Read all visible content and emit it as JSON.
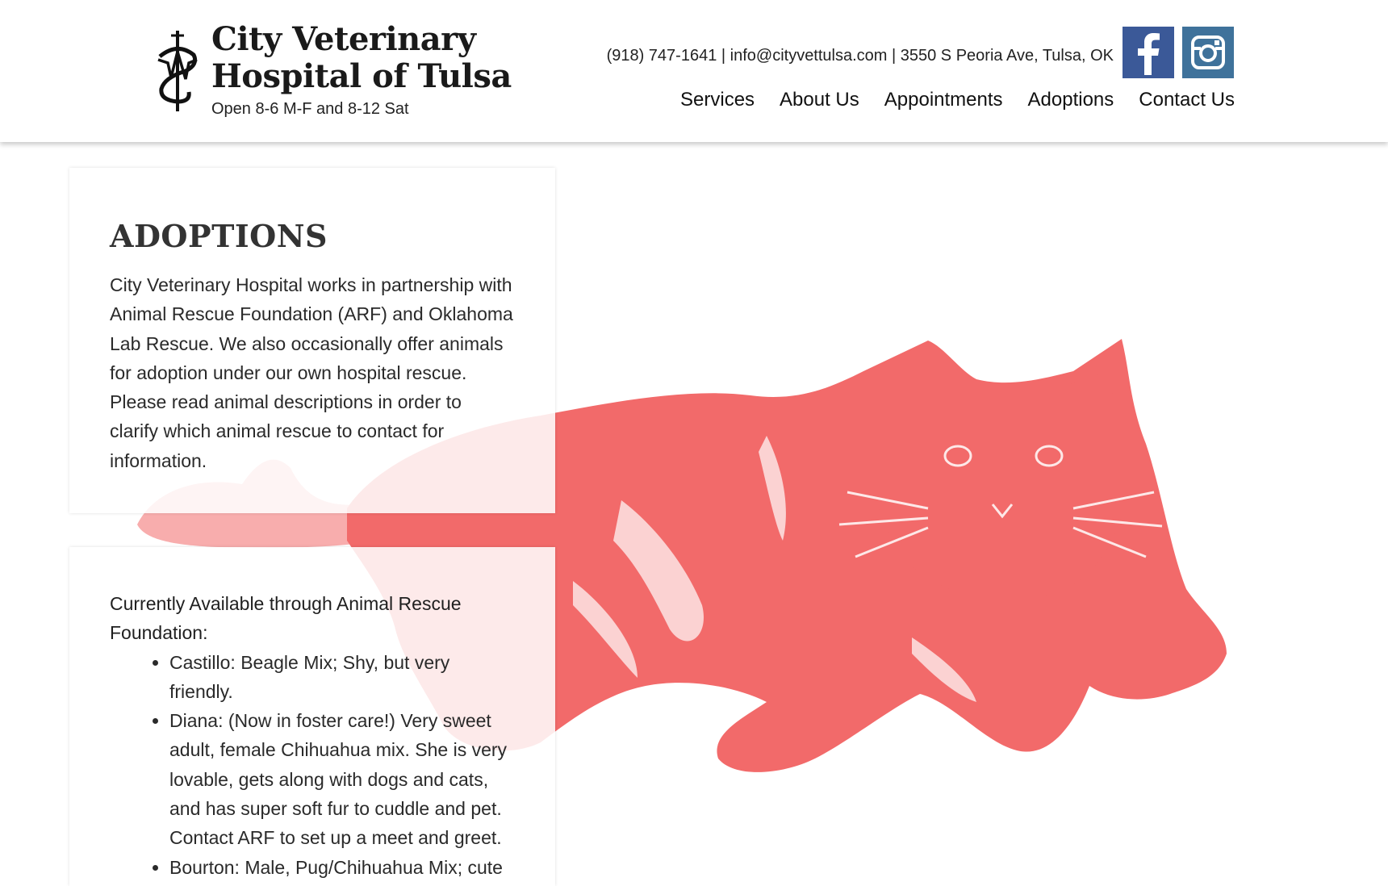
{
  "header": {
    "title_line1": "City Veterinary",
    "title_line2": "Hospital of Tulsa",
    "hours": "Open 8-6 M-F and 8-12 Sat",
    "contact": "(918) 747-1641 | info@cityvettulsa.com | 3550 S Peoria Ave, Tulsa, OK",
    "nav": [
      {
        "label": "Services"
      },
      {
        "label": "About Us"
      },
      {
        "label": "Appointments"
      },
      {
        "label": "Adoptions"
      },
      {
        "label": "Contact Us"
      }
    ],
    "social": [
      {
        "name": "facebook-icon",
        "glyph": "f",
        "color": "#3b5998"
      },
      {
        "name": "instagram-icon",
        "color": "#3f729b"
      }
    ]
  },
  "intro": {
    "heading": "ADOPTIONS",
    "body": "City Veterinary Hospital works in partnership with Animal Rescue Foundation (ARF) and Oklahoma Lab Rescue.  We also occasionally offer animals for adoption under our own hospital rescue. Please read animal descriptions in order to clarify which animal rescue to contact for information."
  },
  "available": {
    "heading": "Currently Available through Animal Rescue Foundation:",
    "items": [
      {
        "text": "Castillo: Beagle Mix; Shy, but very friendly."
      },
      {
        "text": "Diana:  (Now in foster care!) Very sweet adult, female Chihuahua mix.  She is very lovable, gets along with dogs and cats, and has super soft fur to cuddle and pet.  Contact ARF to set up a meet and greet."
      },
      {
        "text": "Bourton:  Male, Pug/Chihuahua Mix; cute"
      }
    ]
  },
  "theme": {
    "accent": "#f26a6a",
    "text": "#222222",
    "background": "#ffffff"
  },
  "hero_image": "cat-photo-red-tint"
}
